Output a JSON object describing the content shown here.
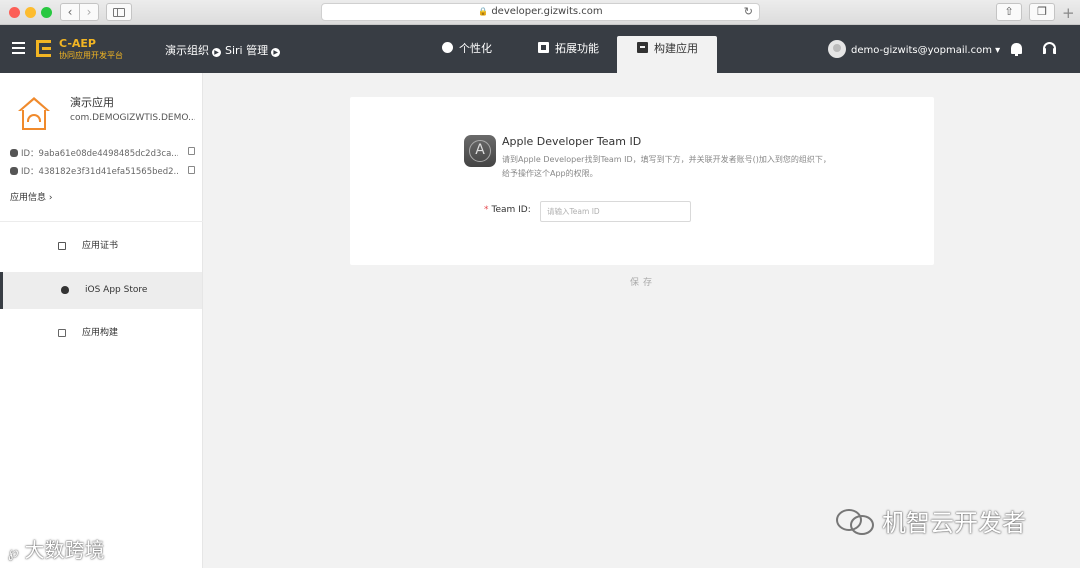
{
  "browser": {
    "url": "developer.gizwits.com",
    "colors": {
      "close": "#fc5f57",
      "minimize": "#fdbc2e",
      "zoom": "#28c840"
    }
  },
  "header": {
    "brand_name": "C-AEP",
    "brand_sub": "协同应用开发平台",
    "crumb_org": "演示组织",
    "crumb_app": "Siri 管理",
    "tabs": [
      {
        "label": "个性化",
        "icon": "palette-icon"
      },
      {
        "label": "拓展功能",
        "icon": "extension-icon"
      },
      {
        "label": "构建应用",
        "icon": "build-icon",
        "active": true
      }
    ],
    "user_email": "demo-gizwits@yopmail.com",
    "colors": {
      "bar": "#383d44",
      "brand": "#f2b523"
    }
  },
  "sidebar": {
    "app_name": "演示应用",
    "bundle_id": "com.DEMOGIZWTIS.DEMO...",
    "ios_id": "ID：9aba61e08de4498485dc2d3ca...",
    "android_id": "ID：438182e3f31d41efa51565bed2...",
    "app_info": "应用信息",
    "items": [
      {
        "label": "应用证书",
        "icon": "certificate-icon"
      },
      {
        "label": "iOS App Store",
        "icon": "apple-icon",
        "active": true
      },
      {
        "label": "应用构建",
        "icon": "layers-icon"
      }
    ]
  },
  "main": {
    "title": "Apple Developer Team ID",
    "description": "请到Apple Developer找到Team ID，填写到下方，并关联开发者账号()加入到您的组织下，给予操作这个App的权限。",
    "field_label": "Team ID:",
    "field_placeholder": "请输入Team ID",
    "field_value": "",
    "save_label": "保存"
  },
  "watermarks": {
    "wechat_account": "机智云开发者",
    "corner": "大数跨境"
  }
}
